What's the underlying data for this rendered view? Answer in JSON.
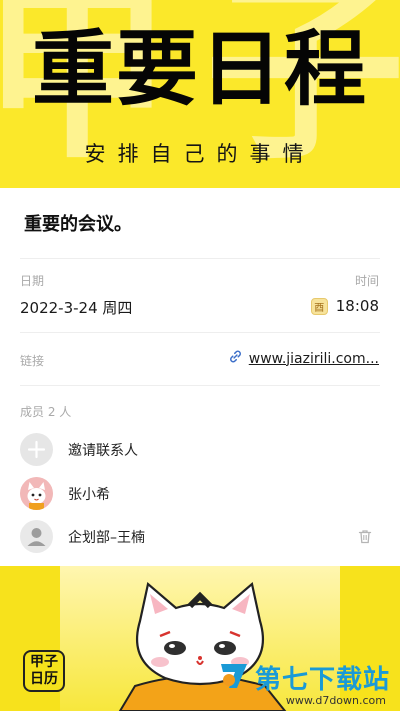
{
  "banner": {
    "bg_glyph_1": "甲",
    "bg_glyph_2": "子",
    "title": "重要日程",
    "subtitle": "安排自己的事情"
  },
  "event": {
    "title": "重要的会议。",
    "date_label": "日期",
    "date_value": "2022-3-24 周四",
    "time_label": "时间",
    "time_tag": "酉",
    "time_value": "18:08",
    "link_label": "链接",
    "link_value": "www.jiazirili.com..."
  },
  "members": {
    "header": "成员 2 人",
    "invite_label": "邀请联系人",
    "list": [
      {
        "name": "张小希"
      },
      {
        "name": "企划部–王楠"
      }
    ]
  },
  "bottom": {
    "logo_line1": "甲子",
    "logo_line2": "日历",
    "watermark_text": "第七下载站",
    "watermark_url": "www.d7down.com"
  },
  "colors": {
    "accent_yellow": "#fbe82a",
    "watermark_blue": "#1a9ad6"
  }
}
